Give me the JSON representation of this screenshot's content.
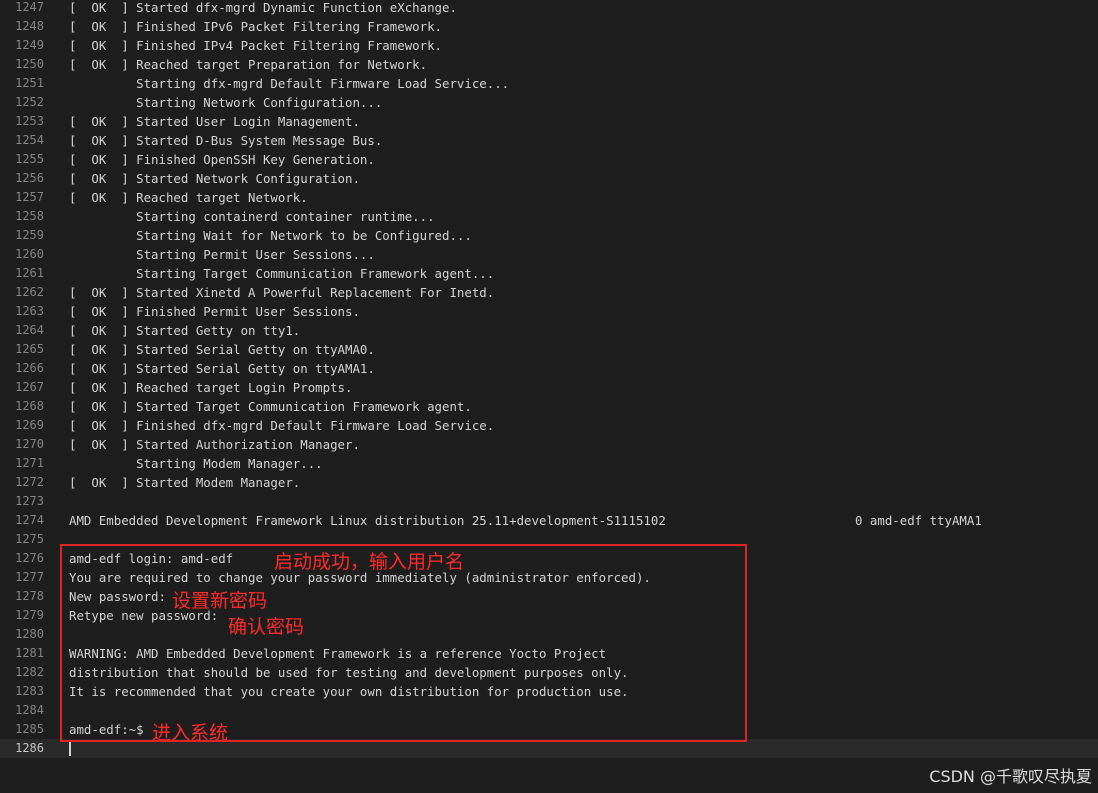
{
  "terminal": {
    "lines": [
      {
        "no": "1247",
        "text": "[  OK  ] Started dfx-mgrd Dynamic Function eXchange."
      },
      {
        "no": "1248",
        "text": "[  OK  ] Finished IPv6 Packet Filtering Framework."
      },
      {
        "no": "1249",
        "text": "[  OK  ] Finished IPv4 Packet Filtering Framework."
      },
      {
        "no": "1250",
        "text": "[  OK  ] Reached target Preparation for Network."
      },
      {
        "no": "1251",
        "text": "         Starting dfx-mgrd Default Firmware Load Service..."
      },
      {
        "no": "1252",
        "text": "         Starting Network Configuration..."
      },
      {
        "no": "1253",
        "text": "[  OK  ] Started User Login Management."
      },
      {
        "no": "1254",
        "text": "[  OK  ] Started D-Bus System Message Bus."
      },
      {
        "no": "1255",
        "text": "[  OK  ] Finished OpenSSH Key Generation."
      },
      {
        "no": "1256",
        "text": "[  OK  ] Started Network Configuration."
      },
      {
        "no": "1257",
        "text": "[  OK  ] Reached target Network."
      },
      {
        "no": "1258",
        "text": "         Starting containerd container runtime..."
      },
      {
        "no": "1259",
        "text": "         Starting Wait for Network to be Configured..."
      },
      {
        "no": "1260",
        "text": "         Starting Permit User Sessions..."
      },
      {
        "no": "1261",
        "text": "         Starting Target Communication Framework agent..."
      },
      {
        "no": "1262",
        "text": "[  OK  ] Started Xinetd A Powerful Replacement For Inetd."
      },
      {
        "no": "1263",
        "text": "[  OK  ] Finished Permit User Sessions."
      },
      {
        "no": "1264",
        "text": "[  OK  ] Started Getty on tty1."
      },
      {
        "no": "1265",
        "text": "[  OK  ] Started Serial Getty on ttyAMA0."
      },
      {
        "no": "1266",
        "text": "[  OK  ] Started Serial Getty on ttyAMA1."
      },
      {
        "no": "1267",
        "text": "[  OK  ] Reached target Login Prompts."
      },
      {
        "no": "1268",
        "text": "[  OK  ] Started Target Communication Framework agent."
      },
      {
        "no": "1269",
        "text": "[  OK  ] Finished dfx-mgrd Default Firmware Load Service."
      },
      {
        "no": "1270",
        "text": "[  OK  ] Started Authorization Manager."
      },
      {
        "no": "1271",
        "text": "         Starting Modem Manager..."
      },
      {
        "no": "1272",
        "text": "[  OK  ] Started Modem Manager."
      },
      {
        "no": "1273",
        "text": ""
      },
      {
        "no": "1274",
        "text": "AMD Embedded Development Framework Linux distribution 25.11+development-S1115102",
        "tty": "0 amd-edf ttyAMA1"
      },
      {
        "no": "1275",
        "text": ""
      },
      {
        "no": "1276",
        "text": "amd-edf login: amd-edf"
      },
      {
        "no": "1277",
        "text": "You are required to change your password immediately (administrator enforced)."
      },
      {
        "no": "1278",
        "text": "New password:"
      },
      {
        "no": "1279",
        "text": "Retype new password:"
      },
      {
        "no": "1280",
        "text": ""
      },
      {
        "no": "1281",
        "text": "WARNING: AMD Embedded Development Framework is a reference Yocto Project"
      },
      {
        "no": "1282",
        "text": "distribution that should be used for testing and development purposes only."
      },
      {
        "no": "1283",
        "text": "It is recommended that you create your own distribution for production use."
      },
      {
        "no": "1284",
        "text": ""
      },
      {
        "no": "1285",
        "text": "amd-edf:~$"
      },
      {
        "no": "1286",
        "text": ""
      }
    ]
  },
  "annotations": {
    "login_success": "启动成功，输入用户名",
    "set_new_password": "设置新密码",
    "confirm_password": "确认密码",
    "enter_system": "进入系统",
    "color": "#ff2a2a"
  },
  "watermark": "CSDN @千歌叹尽执夏",
  "colors": {
    "background": "#1e1e1e",
    "text": "#d4d4d4",
    "line_number": "#858585",
    "highlight_box": "#e02424"
  }
}
